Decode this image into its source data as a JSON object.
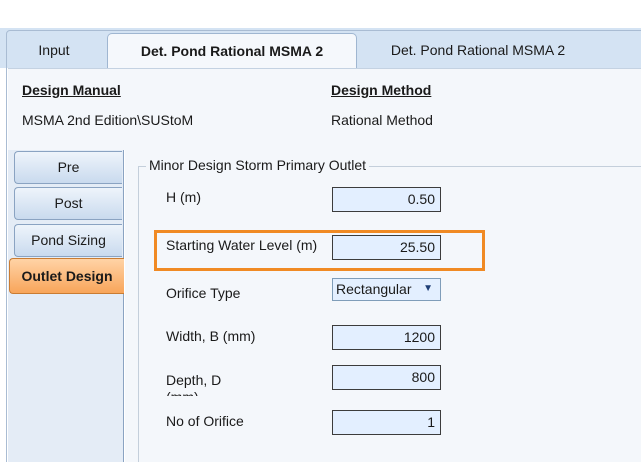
{
  "tabs": [
    {
      "label": "Input"
    },
    {
      "label": "Det. Pond Rational MSMA 2"
    },
    {
      "label": "Det. Pond Rational MSMA 2"
    }
  ],
  "header": {
    "design_manual_label": "Design Manual",
    "design_manual_value": "MSMA 2nd Edition\\SUStoM",
    "design_method_label": "Design Method",
    "design_method_value": "Rational Method"
  },
  "side_tabs": [
    {
      "label": "Pre"
    },
    {
      "label": "Post"
    },
    {
      "label": "Pond Sizing"
    },
    {
      "label": "Outlet Design"
    }
  ],
  "group": {
    "title": "Minor Design Storm Primary Outlet"
  },
  "fields": {
    "h_label": "H (m)",
    "h_value": "0.50",
    "swl_label": "Starting Water Level (m)",
    "swl_value": "25.50",
    "orifice_type_label": "Orifice Type",
    "orifice_type_value": "Rectangular",
    "width_label": "Width, B (mm)",
    "width_value": "1200",
    "depth_label": "Depth, D (mm)",
    "depth_value": "800",
    "no_orifice_label": "No of Orifice",
    "no_orifice_value": "1"
  },
  "colors": {
    "highlight": "#f08a24",
    "active_side_tab": "#f8a55a",
    "input_bg": "#e3efff"
  }
}
